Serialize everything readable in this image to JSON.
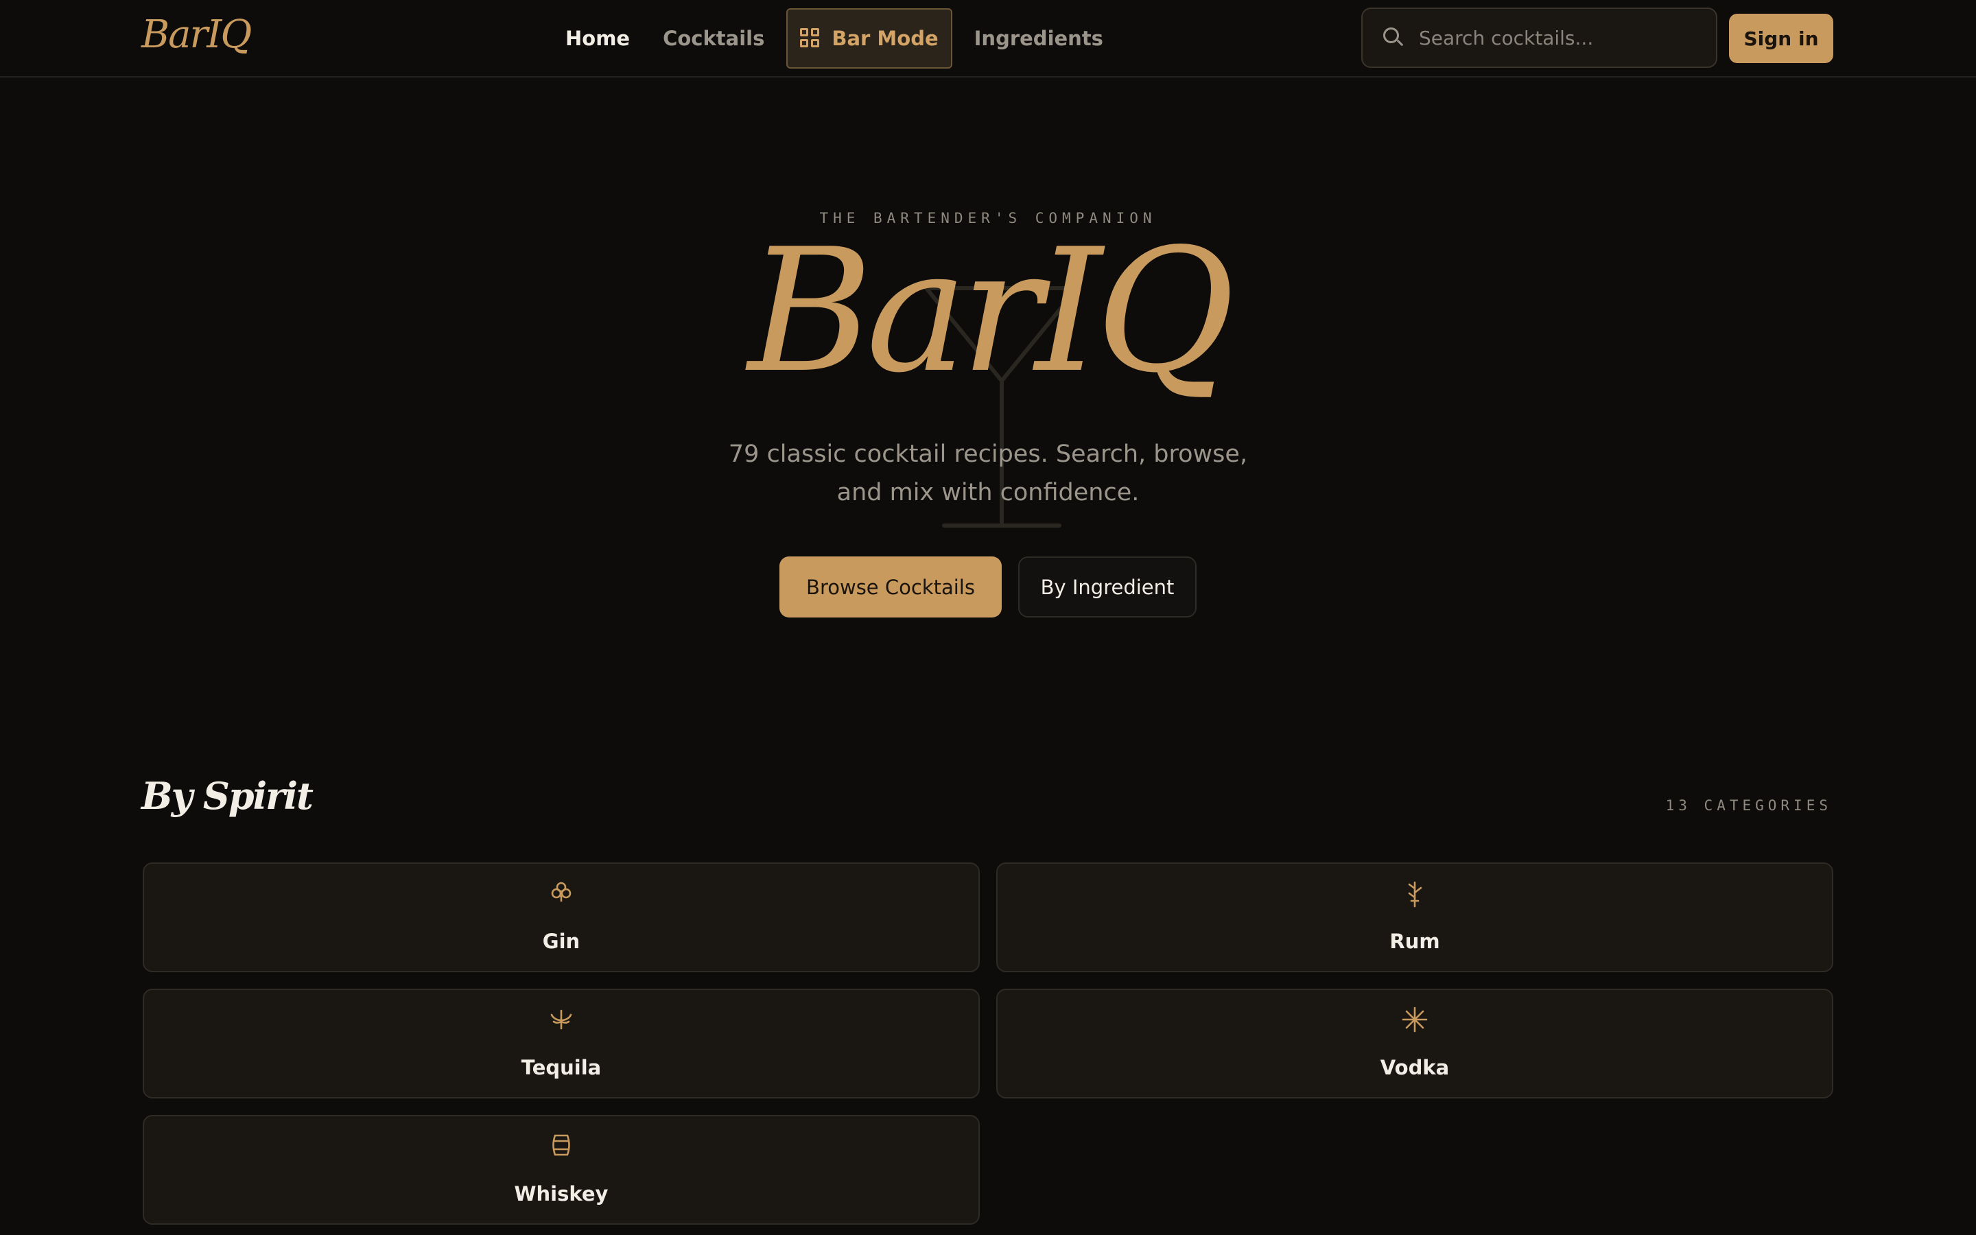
{
  "nav": {
    "brand": "BarIQ",
    "links": [
      {
        "label": "Home"
      },
      {
        "label": "Cocktails"
      },
      {
        "label": "Bar Mode"
      },
      {
        "label": "Ingredients"
      }
    ],
    "search_placeholder": "Search cocktails...",
    "signin_label": "Sign in"
  },
  "hero": {
    "eyebrow": "THE BARTENDER'S COMPANION",
    "title": "BarIQ",
    "subtitle": "79 classic cocktail recipes. Search, browse, and mix with confidence.",
    "primary_label": "Browse Cocktails",
    "secondary_label": "By Ingredient"
  },
  "spirits": {
    "title": "By Spirit",
    "count_label": "13 CATEGORIES",
    "items": [
      {
        "label": "Gin",
        "icon": "clover-icon"
      },
      {
        "label": "Rum",
        "icon": "sugarcane-icon"
      },
      {
        "label": "Tequila",
        "icon": "agave-icon"
      },
      {
        "label": "Vodka",
        "icon": "snowflake-icon"
      },
      {
        "label": "Whiskey",
        "icon": "barrel-icon"
      }
    ]
  },
  "colors": {
    "background": "#0d0c0b",
    "accent": "#c89a5e",
    "card": "#1a1713",
    "muted_text": "#9b958b"
  }
}
